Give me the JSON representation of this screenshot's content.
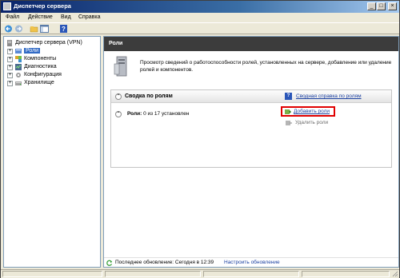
{
  "window": {
    "title": "Диспетчер сервера"
  },
  "titlebar_buttons": {
    "minimize": "_",
    "maximize": "□",
    "close": "×"
  },
  "menu": {
    "file": "Файл",
    "action": "Действие",
    "view": "Вид",
    "help": "Справка"
  },
  "tree": {
    "root": "Диспетчер сервера (VPN)",
    "items": [
      {
        "label": "Роли",
        "selected": true,
        "expander": "+"
      },
      {
        "label": "Компоненты",
        "expander": "+"
      },
      {
        "label": "Диагностика",
        "expander": "+"
      },
      {
        "label": "Конфигурация",
        "expander": "+"
      },
      {
        "label": "Хранилище",
        "expander": "+"
      }
    ]
  },
  "main": {
    "header": "Роли",
    "intro": "Просмотр сведений о работоспособности ролей, установленных на сервере, добавление или удаление ролей и компонентов.",
    "summary": {
      "title": "Сводка по ролям",
      "collapse_glyph": "⌃",
      "help_link": "Сводная справка по ролям",
      "roles_label": "Роли:",
      "roles_value": "0 из 17 установлен",
      "add_roles": "Добавить роли",
      "remove_roles": "Удалить роли"
    },
    "status": {
      "last_update": "Последнее обновление: Сегодня в 12:39",
      "refresh": "Настроить обновление"
    }
  },
  "colors": {
    "accent_blue": "#316ac5",
    "link": "#1a3fa0",
    "highlight_red": "#e00000",
    "header_dark": "#3c3c3c"
  }
}
